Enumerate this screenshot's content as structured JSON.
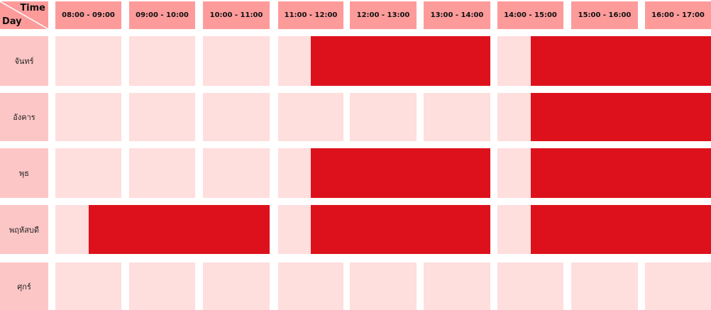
{
  "corner": {
    "time_label": "Time",
    "day_label": "Day"
  },
  "colors": {
    "header_bg": "#fd9b9b",
    "day_label_bg": "#fdc6c6",
    "empty_slot": "#ffdede",
    "booked": "#dd111b"
  },
  "time_slots": [
    "08:00 - 09:00",
    "09:00 - 10:00",
    "10:00 - 11:00",
    "11:00 - 12:00",
    "12:00 - 13:00",
    "13:00 - 14:00",
    "14:00 - 15:00",
    "15:00 - 16:00",
    "16:00 - 17:00"
  ],
  "days": [
    {
      "label": "จันทร์",
      "booked": [
        {
          "start": "11:30",
          "end": "14:00"
        },
        {
          "start": "14:30",
          "end": "17:00"
        }
      ]
    },
    {
      "label": "อังคาร",
      "booked": [
        {
          "start": "14:30",
          "end": "17:00"
        }
      ]
    },
    {
      "label": "พุธ",
      "booked": [
        {
          "start": "11:30",
          "end": "14:00"
        },
        {
          "start": "14:30",
          "end": "17:00"
        }
      ]
    },
    {
      "label": "พฤหัสบดี",
      "booked": [
        {
          "start": "08:30",
          "end": "11:00"
        },
        {
          "start": "11:30",
          "end": "14:00"
        },
        {
          "start": "14:30",
          "end": "17:00"
        }
      ]
    },
    {
      "label": "ศุกร์",
      "booked": []
    }
  ]
}
